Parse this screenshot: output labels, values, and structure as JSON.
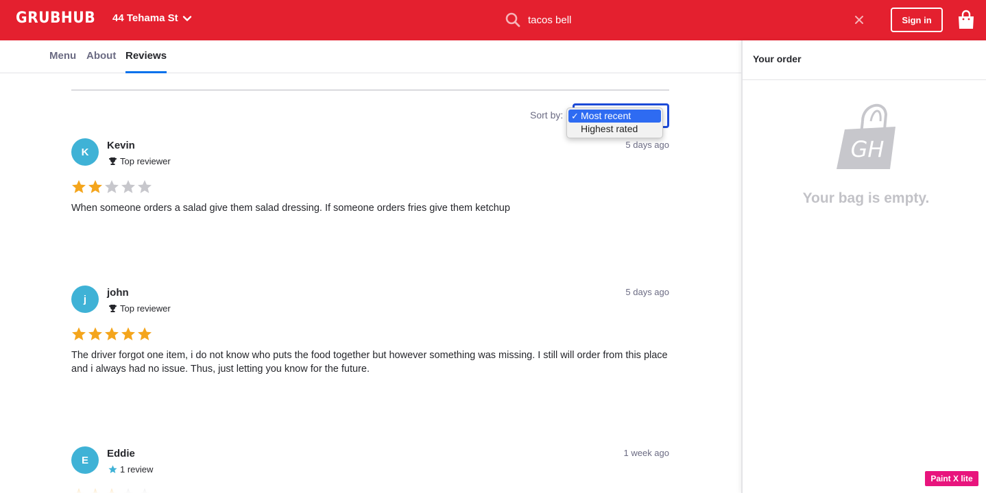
{
  "header": {
    "logo": "GRUBHUB",
    "address": "44 Tehama St",
    "search_value": "tacos bell",
    "signin_label": "Sign in",
    "brand_color": "#e4202f"
  },
  "tabs": [
    {
      "label": "Menu",
      "active": false
    },
    {
      "label": "About",
      "active": false
    },
    {
      "label": "Reviews",
      "active": true
    }
  ],
  "sort": {
    "label": "Sort by:",
    "options": [
      {
        "label": "Most recent",
        "selected": true
      },
      {
        "label": "Highest rated",
        "selected": false
      }
    ]
  },
  "reviews": [
    {
      "initial": "K",
      "name": "Kevin",
      "badge": "Top reviewer",
      "badge_icon": "trophy-icon",
      "date": "5 days ago",
      "rating": 2,
      "text": "When someone orders a salad give them salad dressing. If someone orders fries give them ketchup"
    },
    {
      "initial": "j",
      "name": "john",
      "badge": "Top reviewer",
      "badge_icon": "trophy-icon",
      "date": "5 days ago",
      "rating": 5,
      "text": "The driver forgot one item, i do not know who puts the food together but however something was missing. I still will order from this place and i always had no issue. Thus, just letting you know for the future."
    },
    {
      "initial": "E",
      "name": "Eddie",
      "badge": "1 review",
      "badge_icon": "star-icon",
      "date": "1 week ago",
      "rating": 3,
      "text": ""
    }
  ],
  "sidebar": {
    "title": "Your order",
    "empty_text": "Your bag is empty.",
    "bag_logo": "GH"
  },
  "extension_badge": "Paint X lite",
  "colors": {
    "star_filled": "#f4a51c",
    "star_empty": "#c7c7cc",
    "avatar": "#3fb2d6",
    "tab_active": "#0070eb"
  }
}
